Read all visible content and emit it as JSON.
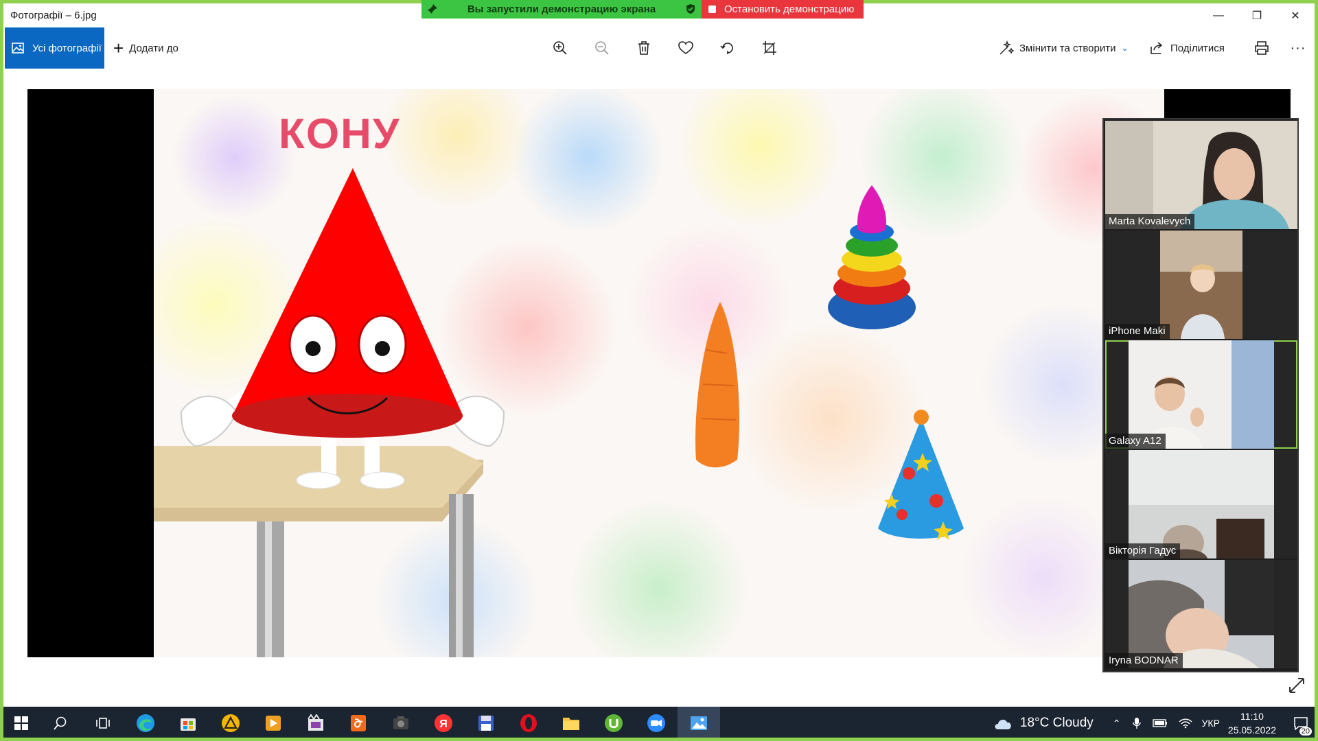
{
  "window": {
    "title": "Фотографії – 6.jpg",
    "controls": {
      "minimize": "—",
      "maximize": "❐",
      "close": "✕"
    }
  },
  "screen_share": {
    "status": "Вы запустили демонстрацию экрана",
    "stop_label": "Остановить демонстрацию",
    "colors": {
      "status_bg": "#3cc542",
      "stop_bg": "#e8363c",
      "frame": "#8fd14f"
    }
  },
  "toolbar": {
    "all_photos": "Усі фотографії",
    "add_to": "Додати до",
    "icons": [
      "zoom-in-icon",
      "zoom-out-icon",
      "delete-icon",
      "favorite-icon",
      "rotate-icon",
      "crop-icon"
    ],
    "edit_create": "Змінити та створити",
    "share": "Поділитися",
    "more": "···"
  },
  "photo": {
    "caption": "КОНУ"
  },
  "participants": [
    {
      "name": "Marta Kovalevych"
    },
    {
      "name": "iPhone Maki"
    },
    {
      "name": "Galaxy A12",
      "active": true
    },
    {
      "name": "Вікторія Гадус"
    },
    {
      "name": "Iryna BODNAR"
    }
  ],
  "taskbar": {
    "weather": "18°C  Cloudy",
    "language": "УКР",
    "time": "11:10",
    "date": "25.05.2022",
    "notifications": "20",
    "pinned_icons": [
      "search-icon",
      "task-view-icon",
      "edge-icon",
      "store-icon",
      "app-triangle-icon",
      "media-player-icon",
      "video-editor-icon",
      "pdf-icon",
      "camera-app-icon",
      "yandex-icon",
      "floppy-icon",
      "opera-icon",
      "file-explorer-icon",
      "utorrent-icon",
      "zoom-icon",
      "photos-icon"
    ]
  }
}
